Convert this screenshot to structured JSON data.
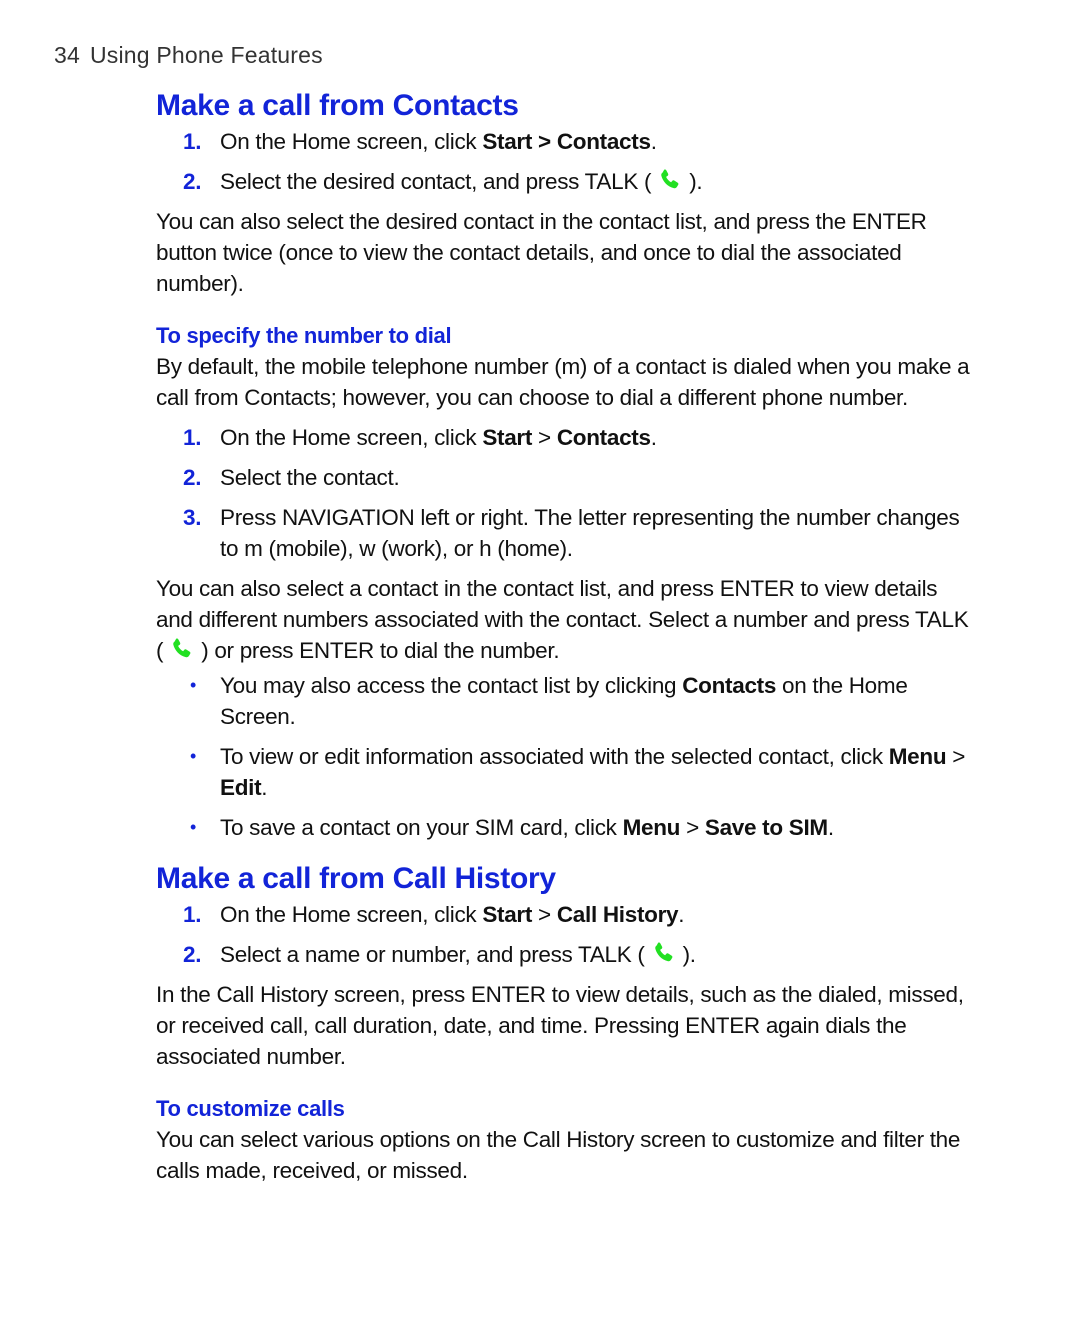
{
  "header": {
    "page_number": "34",
    "section": "Using Phone Features"
  },
  "colors": {
    "heading": "#1224d8",
    "body_text": "#111111",
    "talk_icon": "#22e022"
  },
  "icons": {
    "talk": "phone-handset-icon"
  },
  "contacts": {
    "title": "Make a call from Contacts",
    "steps": [
      {
        "n": "1.",
        "pre": "On the Home screen, click ",
        "b1": "Start > Contacts",
        "post": "."
      },
      {
        "n": "2.",
        "pre": "Select the desired contact, and press TALK (",
        "post": ")."
      }
    ],
    "para": "You can also select the desired contact in the contact list, and press the ENTER button twice (once to view the contact details, and once to dial the associated number).",
    "specify": {
      "title": "To specify the number to dial",
      "para": "By default, the mobile telephone number (m) of a contact is dialed when you make a call from Contacts; however, you can choose to dial a different phone number.",
      "steps": [
        {
          "n": "1.",
          "pre": "On the Home screen, click ",
          "b1": "Start",
          "sep": " > ",
          "b2": "Contacts",
          "post": "."
        },
        {
          "n": "2.",
          "text": "Select the contact."
        },
        {
          "n": "3.",
          "text": "Press NAVIGATION left or right. The letter representing the number changes to m (mobile), w (work), or h (home)."
        }
      ],
      "para2_pre": "You can also select a contact in the contact list, and press ENTER to view details and different numbers associated with the contact. Select a number and press TALK (",
      "para2_post": ") or press ENTER to dial the number.",
      "bullets": [
        {
          "pre": "You may also access the contact list by clicking ",
          "b1": "Contacts",
          "post": " on the Home Screen."
        },
        {
          "pre": "To view or edit information associated with the selected contact, click ",
          "b1": "Menu",
          "sep": " > ",
          "b2": "Edit",
          "post": "."
        },
        {
          "pre": "To save a contact on your SIM card, click ",
          "b1": "Menu",
          "sep": " > ",
          "b2": "Save to SIM",
          "post": "."
        }
      ]
    }
  },
  "history": {
    "title": "Make a call from Call History",
    "steps": [
      {
        "n": "1.",
        "pre": "On the Home screen, click ",
        "b1": "Start",
        "sep": " > ",
        "b2": "Call History",
        "post": "."
      },
      {
        "n": "2.",
        "pre": "Select a name or number, and press TALK (",
        "post": ")."
      }
    ],
    "para": "In the Call History screen, press ENTER to view details, such as the dialed, missed, or received call, call duration, date, and time. Pressing ENTER again dials the associated number.",
    "customize": {
      "title": "To customize calls",
      "para": "You can select various options on the Call History screen to customize and filter the calls made, received, or missed."
    }
  }
}
